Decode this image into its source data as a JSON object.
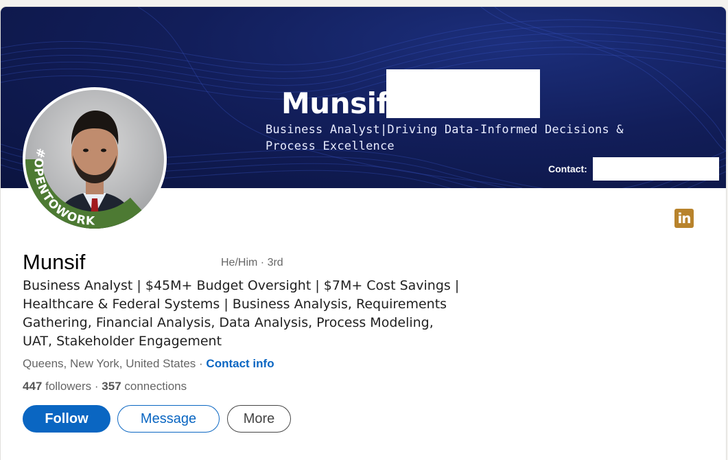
{
  "banner": {
    "name": "Munsif",
    "headline_line1": "Business Analyst|Driving Data-Informed Decisions &",
    "headline_line2": "Process Excellence",
    "contact_label": "Contact: "
  },
  "profile": {
    "badge_text": "#OPENTOWORK",
    "name": "Munsif",
    "pronouns": "He/Him",
    "degree": " · 3rd",
    "headline": "Business Analyst | $45M+ Budget Oversight | $7M+ Cost Savings | Healthcare & Federal Systems | Business Analysis, Requirements Gathering, Financial Analysis, Data Analysis, Process Modeling, UAT, Stakeholder Engagement",
    "location": "Queens, New York, United States",
    "separator": " · ",
    "contact_info": "Contact info",
    "followers_count": "447",
    "followers_label": " followers",
    "connections_count": "357",
    "connections_label": " connections",
    "network_sep": "  · "
  },
  "actions": {
    "follow": "Follow",
    "message": "Message",
    "more": "More"
  },
  "icons": {
    "linkedin": "in"
  },
  "colors": {
    "accent": "#0a66c2",
    "opentowork_green": "#4d7a33",
    "banner_navy": "#121e5a"
  }
}
